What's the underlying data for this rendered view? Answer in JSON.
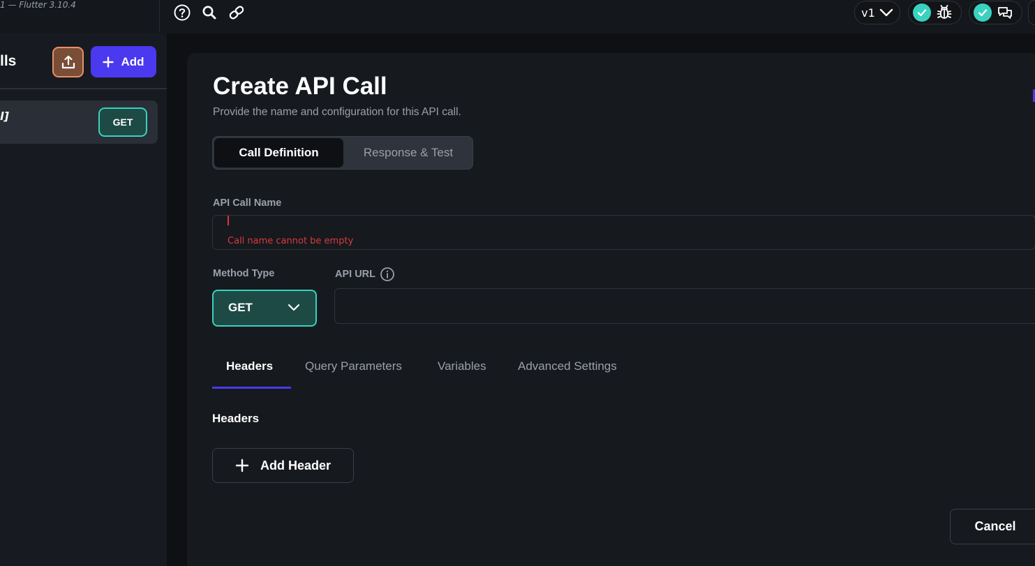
{
  "topbar": {
    "version_text": "1 — Flutter 3.10.4",
    "icons": [
      "help-circle-icon",
      "search-icon",
      "link-icon"
    ],
    "version_selector": "v1",
    "status_pills": [
      {
        "status": "ok",
        "icon": "bug-icon"
      },
      {
        "status": "ok",
        "icon": "chat-icon"
      }
    ]
  },
  "sidebar": {
    "title": "lls",
    "add_label": "Add",
    "items": [
      {
        "name": "l]",
        "method": "GET"
      }
    ]
  },
  "panel": {
    "title": "Create API Call",
    "subtitle": "Provide the name and configuration for this API call.",
    "segments": [
      "Call Definition",
      "Response & Test"
    ],
    "api_call_name_label": "API Call Name",
    "api_call_name_value": "",
    "api_call_name_error": "Call name cannot be empty",
    "method_type_label": "Method Type",
    "method_type_value": "GET",
    "api_url_label": "API URL",
    "api_url_value": "",
    "tabs": [
      "Headers",
      "Query Parameters",
      "Variables",
      "Advanced Settings"
    ],
    "active_tab": "Headers",
    "section_title": "Headers",
    "add_header_label": "Add Header",
    "cancel_label": "Cancel"
  },
  "colors": {
    "accent": "#4b39ef",
    "teal": "#39d2c0",
    "upload_orange": "#e8906a",
    "error_red": "#d63c3c",
    "background": "#0e1014",
    "panel": "#16191e"
  }
}
